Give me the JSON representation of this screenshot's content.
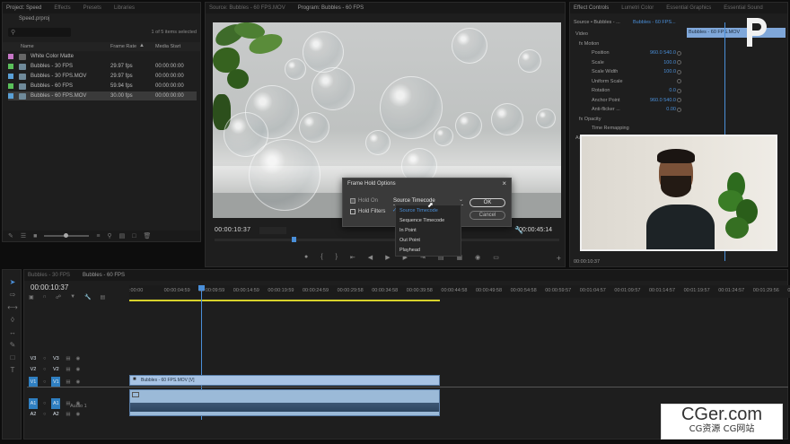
{
  "project": {
    "tabs": [
      "Project: Speed",
      "Effects",
      "Presets",
      "Libraries"
    ],
    "file_name": "Speed.prproj",
    "item_count": "1 of 5 items selected",
    "columns": [
      "Name",
      "Frame Rate",
      "Media Start"
    ],
    "items": [
      {
        "name": "White Color Matte",
        "rate": "",
        "start": "",
        "color": "#c776c7",
        "thumb": false
      },
      {
        "name": "Bubbles - 30 FPS",
        "rate": "29.97 fps",
        "start": "00:00:00:00",
        "color": "#5ac05a",
        "thumb": true
      },
      {
        "name": "Bubbles - 30 FPS.MOV",
        "rate": "29.97 fps",
        "start": "00:00:00:00",
        "color": "#5aa0d6",
        "thumb": true
      },
      {
        "name": "Bubbles - 60 FPS",
        "rate": "59.94 fps",
        "start": "00:00:00:00",
        "color": "#5ac05a",
        "thumb": true
      },
      {
        "name": "Bubbles - 60 FPS.MOV",
        "rate": "30.00 fps",
        "start": "00:00:00:00",
        "color": "#5aa0d6",
        "thumb": true
      }
    ]
  },
  "monitor": {
    "tabs": [
      "Source: Bubbles - 60 FPS.MOV",
      "Program: Bubbles - 60 FPS"
    ],
    "timecode": "00:00:10:37",
    "duration": "00:00:45:14"
  },
  "dialog": {
    "title": "Frame Hold Options",
    "hold_on_label": "Hold On",
    "hold_filters_label": "Hold Filters",
    "selected": "Source Timecode",
    "ok": "OK",
    "cancel": "Cancel",
    "options": [
      "Source Timecode",
      "Sequence Timecode",
      "In Point",
      "Out Point",
      "Playhead"
    ]
  },
  "effects": {
    "tabs": [
      "Effect Controls",
      "Lumetri Color",
      "Essential Graphics",
      "Essential Sound"
    ],
    "source": "Source • Bubbles - ...",
    "clip": "Bubbles - 60 FPS...",
    "timeline_clip": "Bubbles - 60 FPS.MOV",
    "rows": [
      {
        "label": "Video",
        "value": ""
      },
      {
        "label": "fx  Motion",
        "value": ""
      },
      {
        "label": "Position",
        "value": "960.0   540.0"
      },
      {
        "label": "Scale",
        "value": "100.0"
      },
      {
        "label": "Scale Width",
        "value": "100.0"
      },
      {
        "label": "Uniform Scale",
        "value": ""
      },
      {
        "label": "Rotation",
        "value": "0.0"
      },
      {
        "label": "Anchor Point",
        "value": "960.0   540.0"
      },
      {
        "label": "Anti-flicker ...",
        "value": "0.00"
      },
      {
        "label": "fx  Opacity",
        "value": ""
      },
      {
        "label": "Time Remapping",
        "value": ""
      },
      {
        "label": "Audio",
        "value": ""
      }
    ],
    "timecode": "00:00:10:37"
  },
  "timeline": {
    "tabs": [
      "Bubbles - 30 FPS",
      "Bubbles - 60 FPS"
    ],
    "timecode": "00:00:10:37",
    "ruler": [
      ":00:00",
      "00:00:04:59",
      "00:00:09:59",
      "00:00:14:59",
      "00:00:19:59",
      "00:00:24:59",
      "00:00:29:58",
      "00:00:34:58",
      "00:00:39:58",
      "00:00:44:58",
      "00:00:49:58",
      "00:00:54:58",
      "00:00:59:57",
      "00:01:04:57",
      "00:01:09:57",
      "00:01:14:57",
      "00:01:19:57",
      "00:01:24:57",
      "00:01:29:56",
      "00:01:34"
    ],
    "tracks": [
      "V3",
      "V2",
      "V1",
      "A1",
      "A2"
    ],
    "video_clip": "Bubbles - 60 FPS.MOV [V]",
    "audio_label": "Audio 1"
  },
  "watermark": {
    "main": "CGer.com",
    "sub": "CG资源  CG网站"
  }
}
